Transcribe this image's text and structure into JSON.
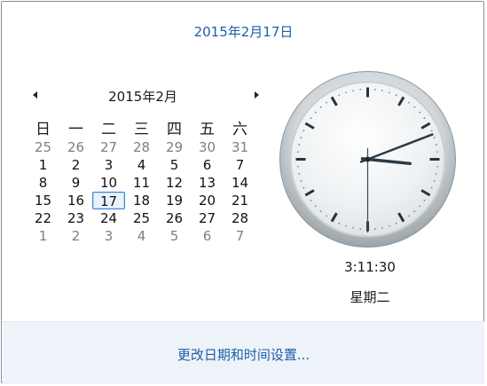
{
  "header": {
    "date_link": "2015年2月17日"
  },
  "calendar": {
    "month_title": "2015年2月",
    "weekdays": [
      "日",
      "一",
      "二",
      "三",
      "四",
      "五",
      "六"
    ],
    "weeks": [
      [
        {
          "d": "25",
          "o": true
        },
        {
          "d": "26",
          "o": true
        },
        {
          "d": "27",
          "o": true
        },
        {
          "d": "28",
          "o": true
        },
        {
          "d": "29",
          "o": true
        },
        {
          "d": "30",
          "o": true
        },
        {
          "d": "31",
          "o": true
        }
      ],
      [
        {
          "d": "1"
        },
        {
          "d": "2"
        },
        {
          "d": "3"
        },
        {
          "d": "4"
        },
        {
          "d": "5"
        },
        {
          "d": "6"
        },
        {
          "d": "7"
        }
      ],
      [
        {
          "d": "8"
        },
        {
          "d": "9"
        },
        {
          "d": "10"
        },
        {
          "d": "11"
        },
        {
          "d": "12"
        },
        {
          "d": "13"
        },
        {
          "d": "14"
        }
      ],
      [
        {
          "d": "15"
        },
        {
          "d": "16"
        },
        {
          "d": "17",
          "t": true
        },
        {
          "d": "18"
        },
        {
          "d": "19"
        },
        {
          "d": "20"
        },
        {
          "d": "21"
        }
      ],
      [
        {
          "d": "22"
        },
        {
          "d": "23"
        },
        {
          "d": "24"
        },
        {
          "d": "25"
        },
        {
          "d": "26"
        },
        {
          "d": "27"
        },
        {
          "d": "28"
        }
      ],
      [
        {
          "d": "1",
          "o": true
        },
        {
          "d": "2",
          "o": true
        },
        {
          "d": "3",
          "o": true
        },
        {
          "d": "4",
          "o": true
        },
        {
          "d": "5",
          "o": true
        },
        {
          "d": "6",
          "o": true
        },
        {
          "d": "7",
          "o": true
        }
      ]
    ]
  },
  "clock": {
    "time_text": "3:11:30",
    "weekday_text": "星期二",
    "hour": 3,
    "minute": 11,
    "second": 30
  },
  "footer": {
    "settings_link": "更改日期和时间设置..."
  },
  "colors": {
    "link": "#1e5ea8",
    "today_border": "#3f86d9",
    "footer_bg": "#eef3fa"
  }
}
